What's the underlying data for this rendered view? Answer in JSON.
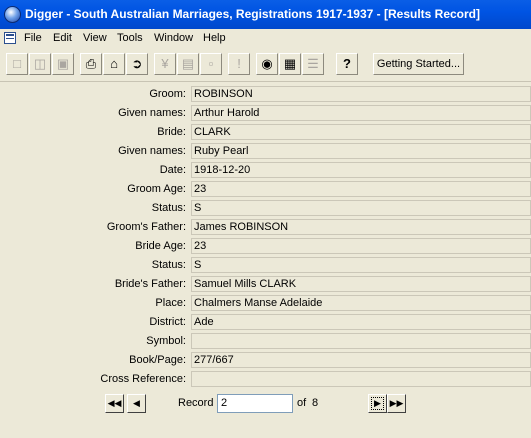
{
  "window": {
    "title": "Digger - South Australian Marriages, Registrations 1917-1937 - [Results Record]"
  },
  "menu": [
    "File",
    "Edit",
    "View",
    "Tools",
    "Window",
    "Help"
  ],
  "toolbar": {
    "getting_started": "Getting Started...",
    "help_glyph": "?"
  },
  "record": [
    {
      "label": "Groom:",
      "value": "ROBINSON"
    },
    {
      "label": "Given names:",
      "value": "Arthur Harold"
    },
    {
      "label": "Bride:",
      "value": "CLARK"
    },
    {
      "label": "Given names:",
      "value": "Ruby Pearl"
    },
    {
      "label": "Date:",
      "value": "1918-12-20"
    },
    {
      "label": "Groom Age:",
      "value": "23"
    },
    {
      "label": "Status:",
      "value": "S"
    },
    {
      "label": "Groom's Father:",
      "value": "James ROBINSON"
    },
    {
      "label": "Bride Age:",
      "value": "23"
    },
    {
      "label": "Status:",
      "value": "S"
    },
    {
      "label": "Bride's Father:",
      "value": "Samuel Mills CLARK"
    },
    {
      "label": "Place:",
      "value": "Chalmers Manse Adelaide"
    },
    {
      "label": "District:",
      "value": "Ade"
    },
    {
      "label": "Symbol:",
      "value": ""
    },
    {
      "label": "Book/Page:",
      "value": "277/667"
    },
    {
      "label": "Cross Reference:",
      "value": ""
    }
  ],
  "navigation": {
    "record_label": "Record",
    "current_record": "2",
    "of_label": "of",
    "total_records": "8"
  }
}
